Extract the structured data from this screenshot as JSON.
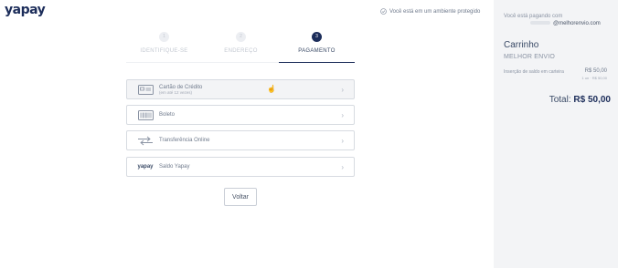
{
  "header": {
    "logo": "yapay",
    "secure_text": "Você está em um ambiente protegido",
    "secure_icon": "shield-check-icon"
  },
  "steps": [
    {
      "number": "1",
      "label": "IDENTIFIQUE-SE",
      "state": "done"
    },
    {
      "number": "2",
      "label": "ENDEREÇO",
      "state": "done"
    },
    {
      "number": "3",
      "label": "PAGAMENTO",
      "state": "active"
    }
  ],
  "payment_methods": [
    {
      "icon": "credit-card-icon",
      "label": "Cartão de Crédito",
      "sub": "(em até 12 vezes)"
    },
    {
      "icon": "barcode-icon",
      "label": "Boleto",
      "sub": ""
    },
    {
      "icon": "transfer-arrows-icon",
      "label": "Transferência Online",
      "sub": ""
    },
    {
      "icon": "yapay-brand-icon",
      "brand_text": "yapay",
      "label": "Saldo Yapay",
      "sub": ""
    }
  ],
  "back_label": "Voltar",
  "aside": {
    "paying_label": "Você está pagando com",
    "user_handle": "@melhorenvio.com",
    "cart_title": "Carrinho",
    "merchant": "MELHOR ENVIO",
    "item_name": "Inserção de saldo em carteira",
    "item_price": "R$ 50,00",
    "item_qty": "1 un · R$ 50,00",
    "total_label": "Total:",
    "total_value": "R$ 50,00"
  },
  "colors": {
    "brand": "#1c2d5a",
    "sidebar_bg": "#f3f4f6",
    "border": "#d7dbe1"
  }
}
